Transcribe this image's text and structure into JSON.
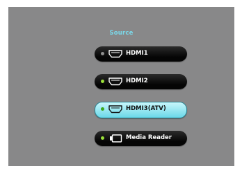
{
  "menu": {
    "title": "Source",
    "items": [
      {
        "label": "HDMI1",
        "icon": "hdmi-port-icon",
        "dot_color": "#8f8f8f",
        "selected": false
      },
      {
        "label": "HDMI2",
        "icon": "hdmi-port-icon",
        "dot_color": "#9be03a",
        "selected": false
      },
      {
        "label": "HDMI3(ATV)",
        "icon": "hdmi-port-icon",
        "dot_color": "#4fbf1f",
        "selected": true
      },
      {
        "label": "Media Reader",
        "icon": "usb-port-icon",
        "dot_color": "#9be03a",
        "selected": false
      }
    ]
  },
  "colors": {
    "background": "#888889",
    "title": "#7ad7e8",
    "selected_fill": "#9fe8f2"
  }
}
